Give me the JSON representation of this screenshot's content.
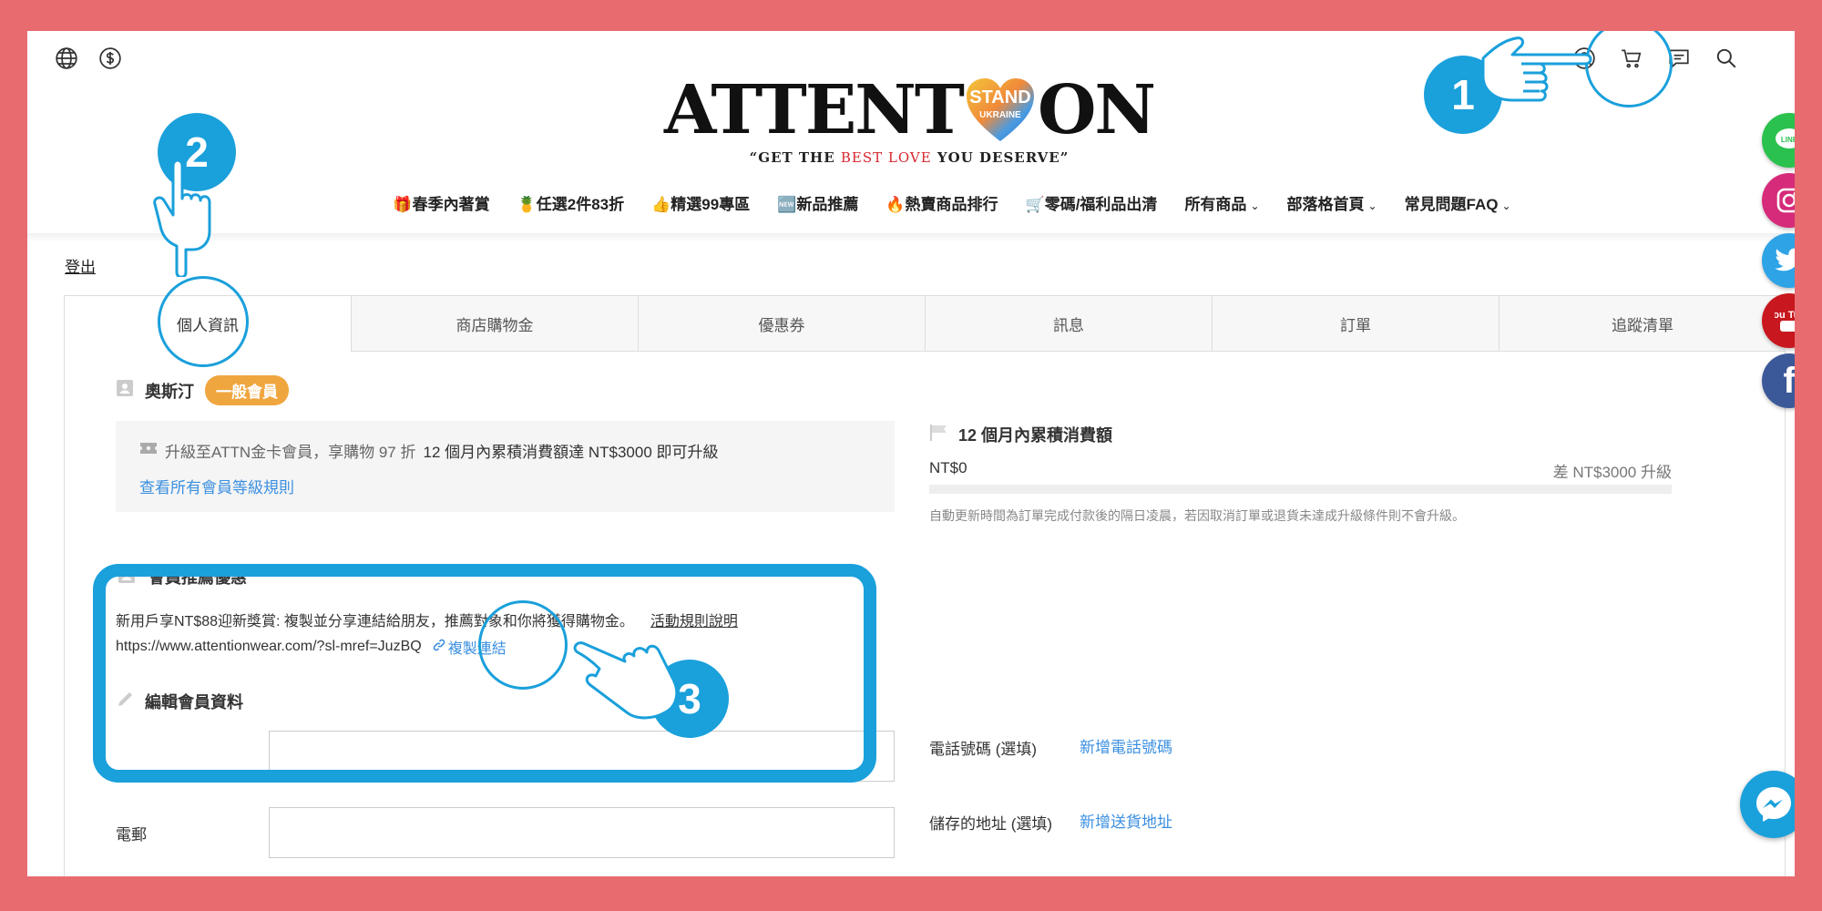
{
  "logo": {
    "title_left": "ATTENT",
    "title_right": "ON",
    "heart_top": "STAND",
    "heart_bottom": "UKRAINE",
    "tagline_a": "“GET THE ",
    "tagline_red": "BEST LOVE",
    "tagline_b": " YOU DESERVE”"
  },
  "header_icons_left": [
    "globe-icon",
    "dollar-icon"
  ],
  "header_icons_right": [
    "user-icon",
    "cart-icon",
    "message-icon",
    "search-icon"
  ],
  "nav": [
    {
      "label": "🎁春季內著賞"
    },
    {
      "label": "🍍任選2件83折"
    },
    {
      "label": "👍精選99專區"
    },
    {
      "label": "🆕新品推薦"
    },
    {
      "label": "🔥熱賣商品排行"
    },
    {
      "label": "🛒零碼/福利品出清"
    },
    {
      "label": "所有商品",
      "dropdown": true
    },
    {
      "label": "部落格首頁",
      "dropdown": true
    },
    {
      "label": "常見問題FAQ",
      "dropdown": true
    }
  ],
  "logout": "登出",
  "tabs": [
    "個人資訊",
    "商店購物金",
    "優惠券",
    "訊息",
    "訂單",
    "追蹤清單"
  ],
  "member": {
    "name": "奧斯汀",
    "badge": "一般會員"
  },
  "upgrade": {
    "text_a": "升級至ATTN金卡會員，享購物 97 折",
    "text_b": "12 個月內累積消費額達 NT$3000 即可升級",
    "link": "查看所有會員等級規則"
  },
  "spend": {
    "title": "12 個月內累積消費額",
    "amount": "NT$0",
    "diff": "差 NT$3000 升級",
    "progress": 0,
    "note": "自動更新時間為訂單完成付款後的隔日凌晨，若因取消訂單或退貨未達成升級條件則不會升級。"
  },
  "referral": {
    "title": "會員推薦優惠",
    "desc": "新用戶享NT$88迎新獎賞: 複製並分享連結給朋友，推薦對象和你將獲得購物金。",
    "rules": "活動規則說明",
    "url": "https://www.attentionwear.com/?sl-mref=JuzBQ",
    "copy": "複製連結"
  },
  "edit": {
    "title": "編輯會員資料",
    "email_label": "電郵",
    "phone_label": "電話號碼 (選填)",
    "phone_link": "新增電話號碼",
    "address_label": "儲存的地址 (選填)",
    "address_link": "新增送貨地址"
  },
  "steps": [
    "1",
    "2",
    "3"
  ],
  "social": [
    {
      "name": "line",
      "label": "LINE",
      "color": "#2bc14e"
    },
    {
      "name": "instagram",
      "label": "IG",
      "color": "#d62b7a"
    },
    {
      "name": "twitter",
      "label": "t",
      "color": "#2ea3e6"
    },
    {
      "name": "youtube",
      "label": "You Tube",
      "color": "#c8171e"
    },
    {
      "name": "facebook",
      "label": "f",
      "color": "#3b5998"
    }
  ],
  "colors": {
    "accent": "#1aa0db",
    "frame": "#e86b70",
    "badge": "#f0a63f",
    "link": "#3b8fe0"
  }
}
